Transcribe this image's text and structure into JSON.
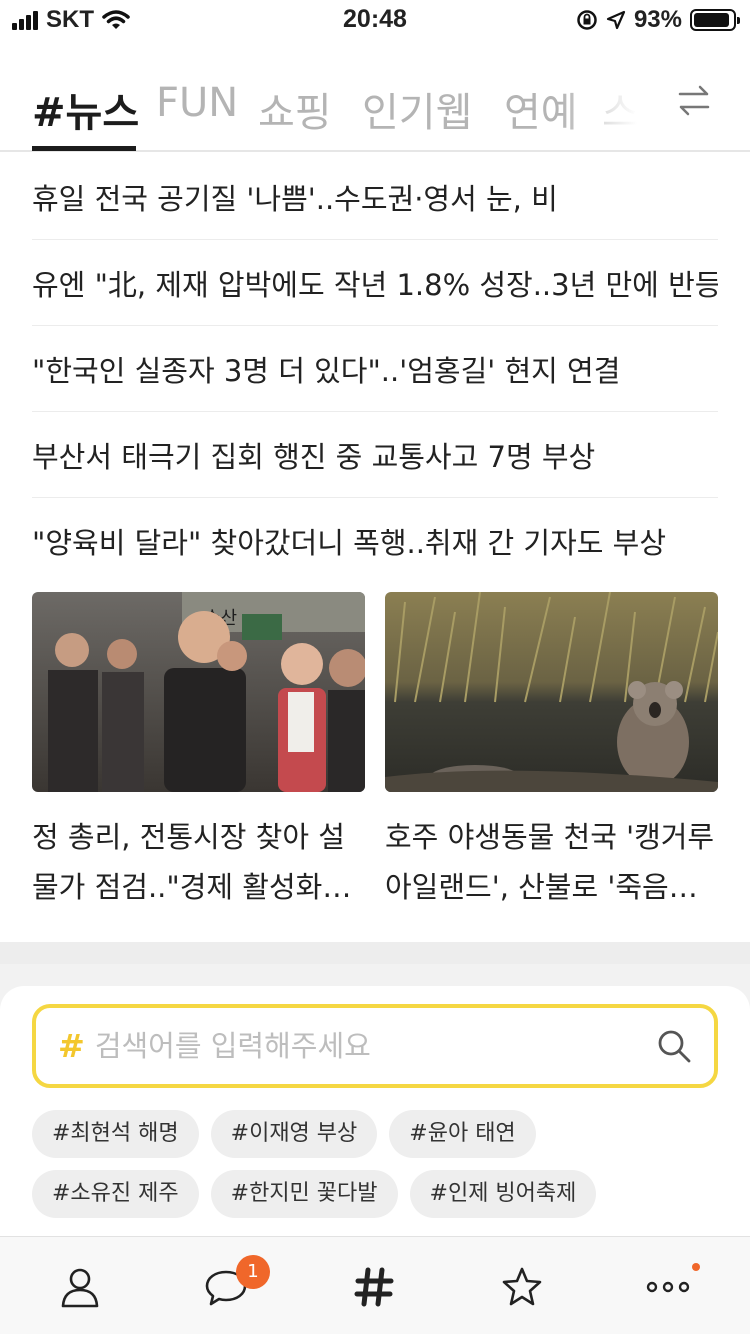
{
  "status_bar": {
    "carrier": "SKT",
    "time": "20:48",
    "battery": "93%",
    "battery_level": 0.93
  },
  "tabs": [
    {
      "label": "#뉴스",
      "active": true
    },
    {
      "label": "FUN",
      "active": false
    },
    {
      "label": "쇼핑",
      "active": false
    },
    {
      "label": "인기웹",
      "active": false
    },
    {
      "label": "연예",
      "active": false
    },
    {
      "label": "스",
      "active": false
    }
  ],
  "headlines": [
    "휴일 전국 공기질 '나쁨'..수도권·영서 눈, 비",
    "유엔 \"北, 제재 압박에도 작년 1.8% 성장..3년 만에 반등\"",
    "\"한국인 실종자 3명 더 있다\"..'엄홍길' 현지 연결",
    "부산서 태극기 집회 행진 중 교통사고 7명 부상",
    "\"양육비 달라\" 찾아갔더니 폭행..취재 간 기자도 부상"
  ],
  "cards": [
    {
      "title": "정 총리, 전통시장 찾아 설 물가 점검..\"경제 활성화에..."
    },
    {
      "title": "호주 야생동물 천국 '캥거루 아일랜드', 산불로 '죽음의..."
    }
  ],
  "photo_signs": {
    "market_sign": "수산"
  },
  "search": {
    "hash": "#",
    "placeholder": "검색어를 입력해주세요"
  },
  "chips": [
    [
      "#최현석 해명",
      "#이재영 부상",
      "#윤아 태연"
    ],
    [
      "#소유진 제주",
      "#한지민 꽃다발",
      "#인제 빙어축제"
    ]
  ],
  "nav": {
    "badge_count": "1",
    "accent": "#f0672a"
  },
  "colors": {
    "search_border": "#f5d742",
    "hash": "#f3c72d"
  }
}
